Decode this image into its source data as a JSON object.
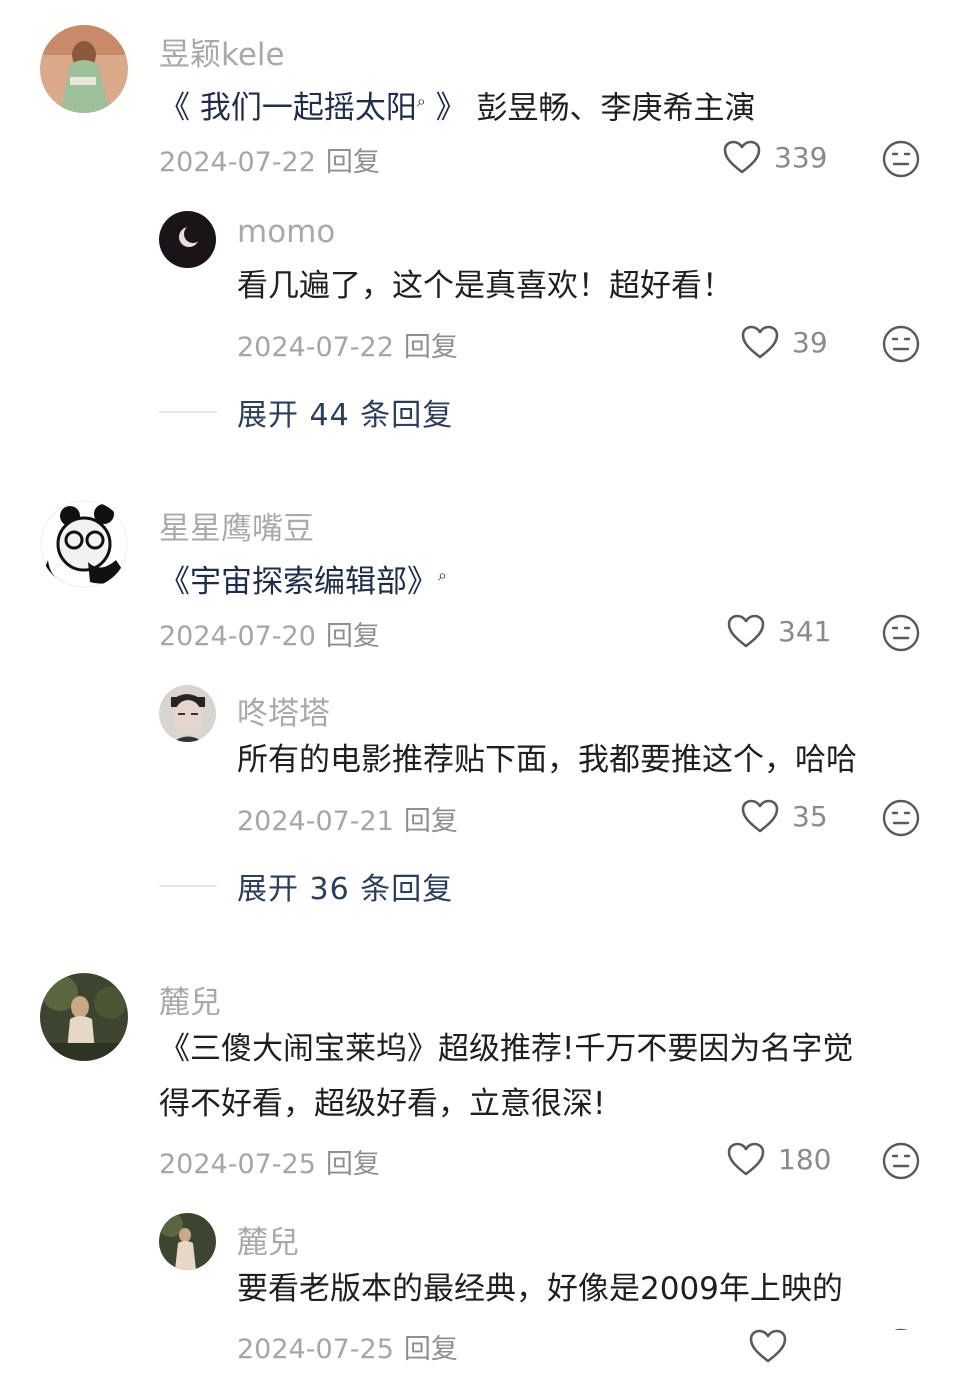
{
  "comments": [
    {
      "user": "昱颖kele",
      "text_title": "《 我们一起摇太阳",
      "text_title_end": " 》",
      "text_rest": "彭昱畅、李庚希主演",
      "date": "2024-07-22",
      "reply_label": "回复",
      "likes": "339",
      "sub": {
        "user": "momo",
        "text": "看几遍了，这个是真喜欢！超好看！",
        "date": "2024-07-22",
        "reply_label": "回复",
        "likes": "39"
      },
      "expand": "展开 44 条回复"
    },
    {
      "user": "星星鹰嘴豆",
      "text_title": "《宇宙探索编辑部》",
      "date": "2024-07-20",
      "reply_label": "回复",
      "likes": "341",
      "sub": {
        "user": "咚塔塔",
        "text": "所有的电影推荐贴下面，我都要推这个，哈哈",
        "date": "2024-07-21",
        "reply_label": "回复",
        "likes": "35"
      },
      "expand": "展开 36 条回复"
    },
    {
      "user": "麓兒",
      "text_line1": "《三傻大闹宝莱坞》超级推荐!千万不要因为名字觉",
      "text_line2": "得不好看，超级好看，立意很深!",
      "date": "2024-07-25",
      "reply_label": "回复",
      "likes": "180",
      "sub": {
        "user": "麓兒",
        "text": "要看老版本的最经典，好像是2009年上映的",
        "date": "2024-07-25",
        "reply_label": "回复"
      }
    }
  ],
  "icons": {
    "like": "heart-outline-icon",
    "dislike": "neutral-face-icon",
    "search_mark": "search-icon"
  },
  "colors": {
    "username": "#a9a9a9",
    "text": "#1f1f1f",
    "meta": "#a6a6a6",
    "expand": "#2c3e5c"
  }
}
